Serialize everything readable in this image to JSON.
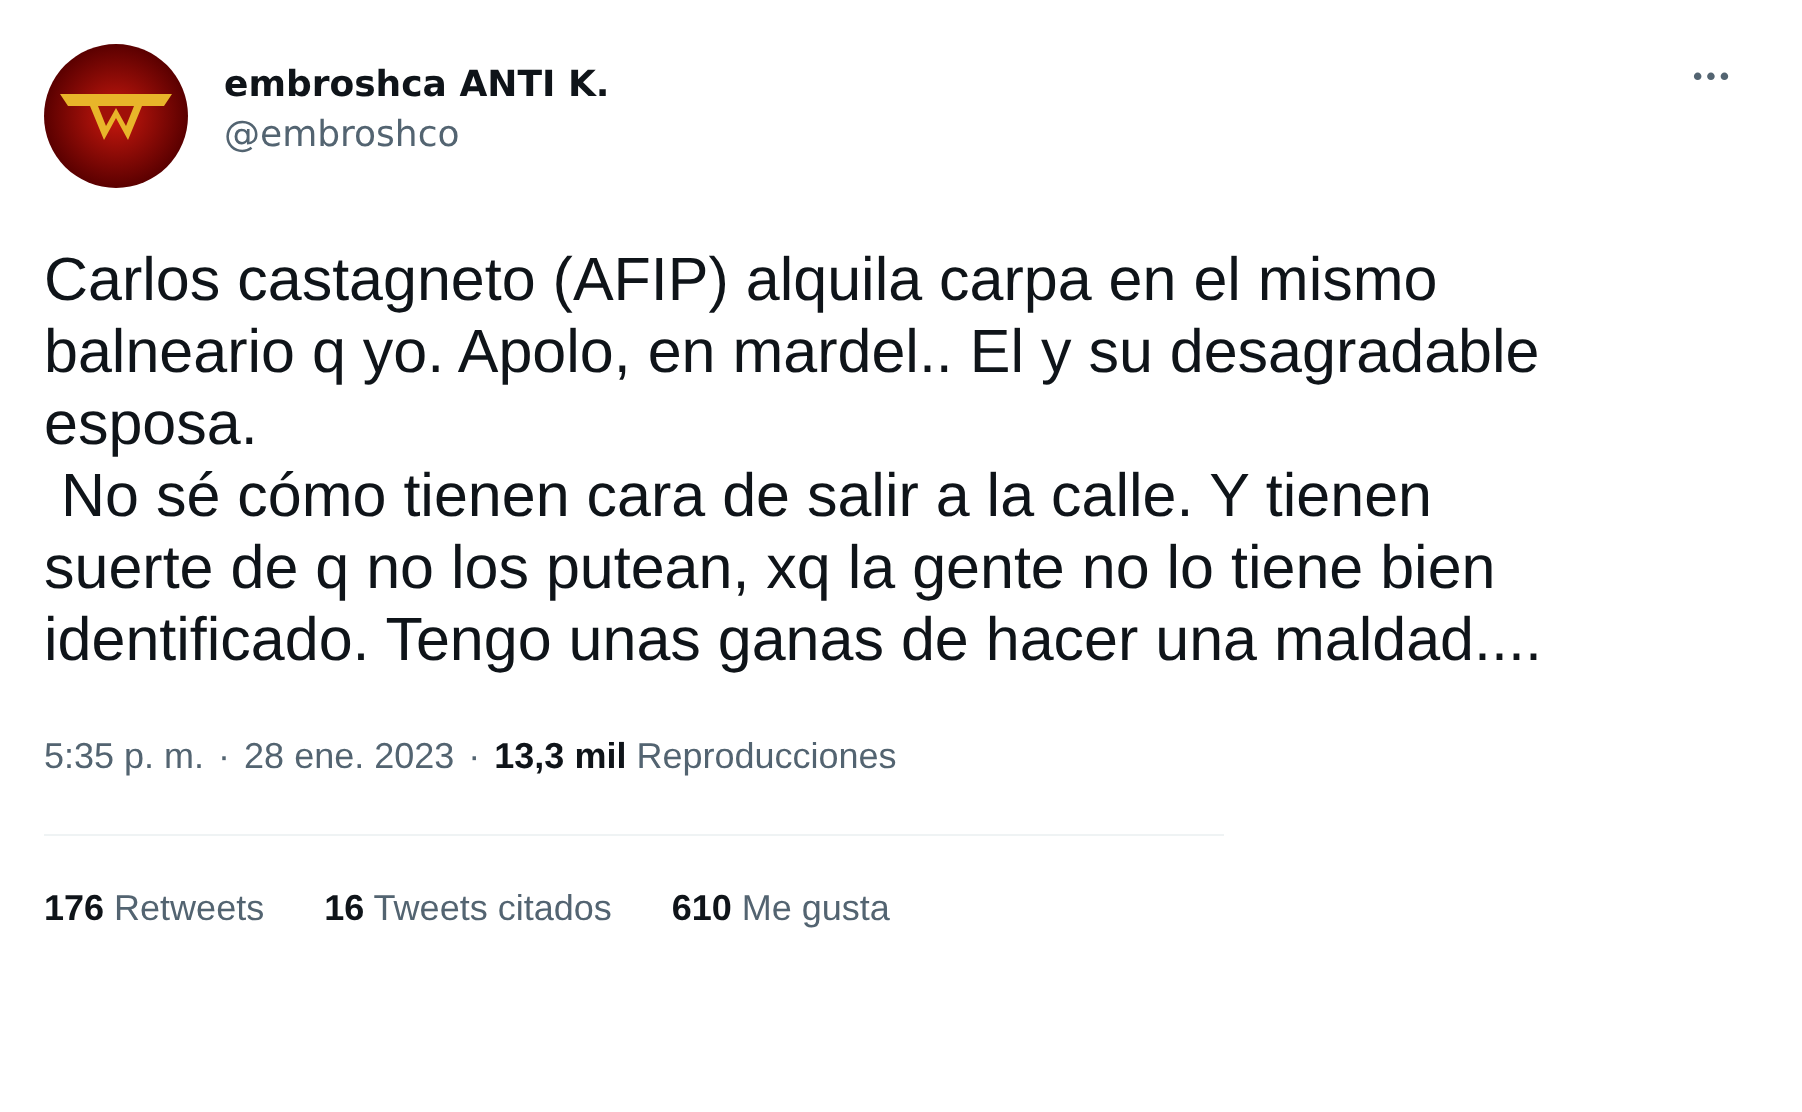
{
  "author": {
    "name": "embroshca ANTI K.",
    "handle": "@embroshco"
  },
  "more_button": "•••",
  "tweet_paragraphs": [
    "Carlos castagneto (AFIP) alquila carpa en el mismo balneario q yo. Apolo, en mardel.. El y su desagradable esposa.",
    " No sé cómo tienen cara de salir a la calle. Y tienen suerte de q no los putean, xq la gente no lo tiene bien identificado. Tengo unas ganas de hacer una maldad...."
  ],
  "meta": {
    "time": "5:35 p. m.",
    "separator_1": "·",
    "date": "28 ene. 2023",
    "separator_2": "·",
    "views_count": "13,3 mil",
    "views_label": "Reproducciones"
  },
  "stats": [
    {
      "count": "176",
      "label": "Retweets"
    },
    {
      "count": "16",
      "label": "Tweets citados"
    },
    {
      "count": "610",
      "label": "Me gusta"
    }
  ]
}
